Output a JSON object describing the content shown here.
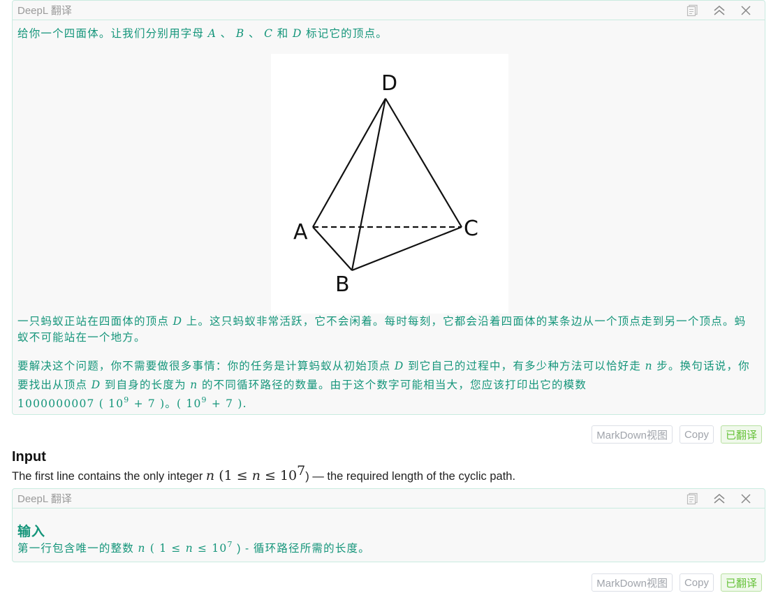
{
  "panels": [
    {
      "title": "DeepL 翻译",
      "icons": [
        "copy-icon",
        "collapse-icon",
        "close-icon"
      ],
      "p1": {
        "pre": "给你一个四面体。让我们分别用字母 ",
        "A": "A",
        "sep1": " 、 ",
        "B": "B",
        "sep2": " 、 ",
        "C": "C",
        "and": " 和 ",
        "D": "D",
        "post": " 标记它的顶点。"
      },
      "figure": {
        "labels": {
          "A": "A",
          "B": "B",
          "C": "C",
          "D": "D"
        }
      },
      "p2": {
        "pre": "一只蚂蚁正站在四面体的顶点 ",
        "D": "D",
        "post": " 上。这只蚂蚁非常活跃，它不会闲着。每时每刻，它都会沿着四面体的某条边从一个顶点走到另一个顶点。蚂蚁不可能站在一个地方。"
      },
      "p3": {
        "a": "要解决这个问题，你不需要做很多事情：你的任务是计算蚂蚁从初始顶点 ",
        "D1": "D",
        "b": " 到它自己的过程中，有多少种方法可以恰好走 ",
        "n1": "n",
        "c": " 步。换句话说，你要找出从顶点 ",
        "D2": "D",
        "d": " 到自身的长度为 ",
        "n2": "n",
        "e": " 的不同循环路径的数量。由于这个数字可能相当大，您应该打印出它的模数",
        "mod": "1000000007",
        "f": " ( 10",
        "exp": "9",
        "g": " + 7 )。( 10",
        "exp2": "9",
        "h": " + 7 )."
      }
    },
    {
      "title": "DeepL 翻译",
      "icons": [
        "copy-icon",
        "collapse-icon",
        "close-icon"
      ],
      "heading": "输入",
      "line": {
        "pre": "第一行包含唯一的整数 ",
        "n": "n",
        "mid1": " ( 1 ≤ ",
        "n2": "n",
        "mid2": " ≤ 10",
        "exp": "7",
        "post": " ) - 循环路径所需的长度。"
      }
    }
  ],
  "actions": {
    "markdown": "MarkDown视图",
    "copy": "Copy",
    "translated": "已翻译"
  },
  "input_section": {
    "title": "Input",
    "pre": "The first line contains the only integer ",
    "n": "n",
    "paren_open": " (1 ≤ ",
    "n2": "n",
    "le": " ≤ 10",
    "exp": "7",
    "post": ") — the required length of the cyclic path."
  },
  "colors": {
    "accent_text": "#14957a",
    "panel_border": "#c9ebe0",
    "translated_green": "#67c23a"
  }
}
